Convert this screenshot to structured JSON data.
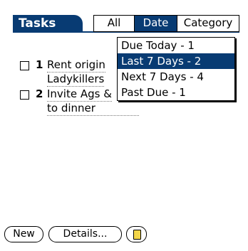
{
  "app": {
    "title": "Tasks"
  },
  "filter_tabs": [
    {
      "label": "All",
      "selected": false
    },
    {
      "label": "Date",
      "selected": true
    },
    {
      "label": "Category",
      "selected": false
    }
  ],
  "tasks": [
    {
      "number": "1",
      "lines": [
        "Rent origin",
        "Ladykillers"
      ],
      "checked": false
    },
    {
      "number": "2",
      "lines": [
        "Invite Ags &",
        "to dinner"
      ],
      "checked": false
    }
  ],
  "date_menu": {
    "items": [
      {
        "label": "Due Today - 1",
        "selected": false
      },
      {
        "label": "Last 7 Days - 2",
        "selected": true
      },
      {
        "label": "Next 7 Days - 4",
        "selected": false
      },
      {
        "label": "Past Due - 1",
        "selected": false
      }
    ]
  },
  "buttons": {
    "new_label": "New",
    "details_label": "Details...",
    "note_icon": "note-icon"
  },
  "colors": {
    "accent": "#083b73",
    "note": "#f3d64a"
  }
}
